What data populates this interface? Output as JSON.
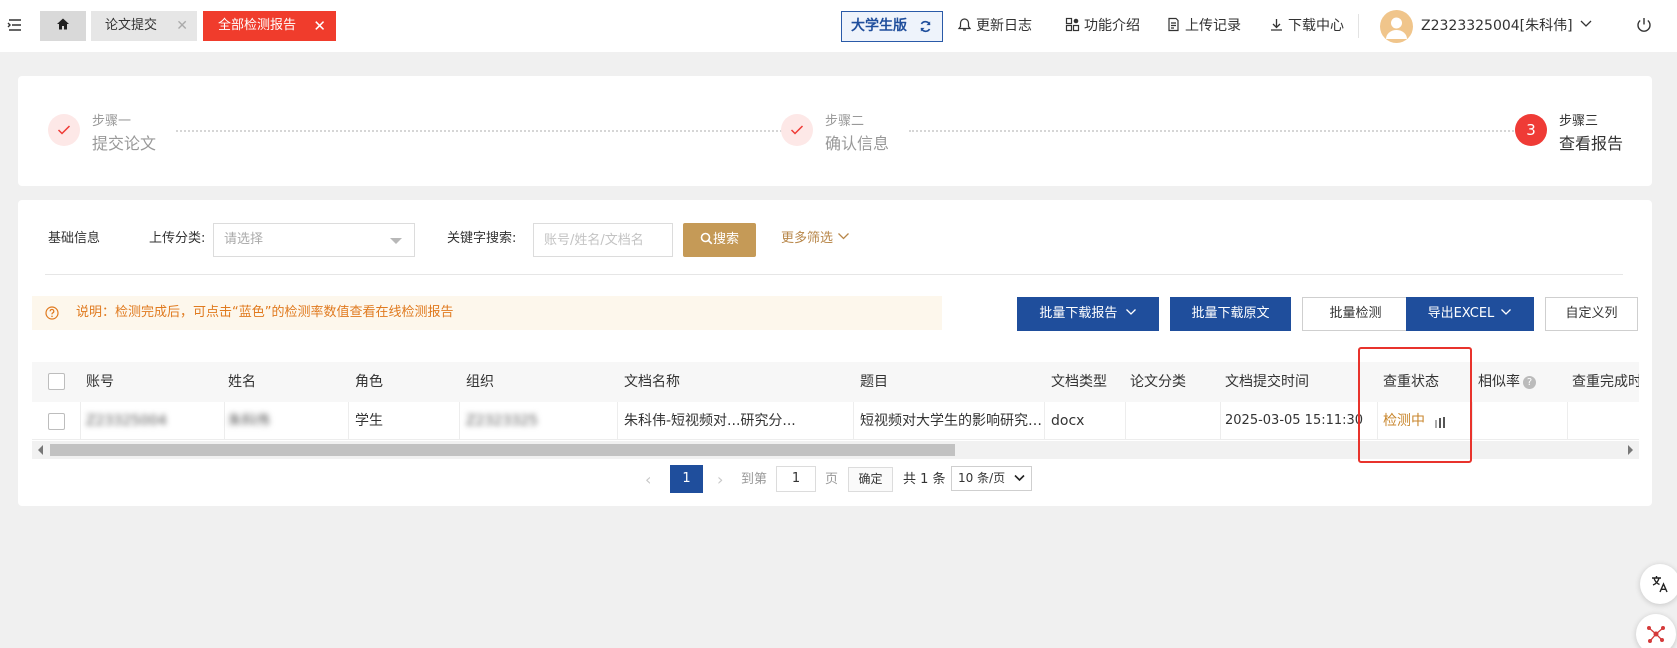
{
  "topbar": {
    "tabs": [
      {
        "label": ""
      },
      {
        "label": "论文提交"
      },
      {
        "label": "全部检测报告"
      }
    ],
    "version_label": "大学生版",
    "nav": {
      "update_log": "更新日志",
      "features": "功能介绍",
      "upload_records": "上传记录",
      "download_center": "下载中心"
    },
    "user_name": "Z2323325004[朱科伟]"
  },
  "steps": [
    {
      "sub": "步骤一",
      "main": "提交论文",
      "state": "done"
    },
    {
      "sub": "步骤二",
      "main": "确认信息",
      "state": "done"
    },
    {
      "number": "3",
      "sub": "步骤三",
      "main": "查看报告",
      "state": "current"
    }
  ],
  "filters": {
    "basic_info": "基础信息",
    "upload_category_label": "上传分类:",
    "upload_category_placeholder": "请选择",
    "keyword_label": "关键字搜索:",
    "keyword_placeholder": "账号/姓名/文档名",
    "search_button": "搜索",
    "more_filters": "更多筛选"
  },
  "notice": "说明：检测完成后，可点击“蓝色”的检测率数值查看在线检测报告",
  "actions": {
    "batch_download_report": "批量下载报告",
    "batch_download_original": "批量下载原文",
    "batch_check": "批量检测",
    "export_excel": "导出EXCEL",
    "custom_columns": "自定义列"
  },
  "table": {
    "headers": {
      "account": "账号",
      "name": "姓名",
      "role": "角色",
      "org": "组织",
      "doc_name": "文档名称",
      "title": "题目",
      "doc_type": "文档类型",
      "paper_category": "论文分类",
      "submit_time": "文档提交时间",
      "check_status": "查重状态",
      "similarity": "相似率",
      "finish_time": "查重完成时"
    },
    "rows": [
      {
        "account": "Z23325004",
        "name": "朱科伟",
        "role": "学生",
        "org": "Z2323325",
        "doc_name": "朱科伟-短视频对...研究分...",
        "title": "短视频对大学生的影响研究分...",
        "doc_type": "docx",
        "paper_category": "",
        "submit_time": "2025-03-05 15:11:30",
        "check_status": "检测中",
        "similarity": "",
        "finish_time": ""
      }
    ]
  },
  "pagination": {
    "current_page": "1",
    "goto_label": "到第",
    "goto_value": "1",
    "page_unit": "页",
    "confirm": "确定",
    "total": "共 1 条",
    "page_size": "10 条/页"
  },
  "colors": {
    "brand_blue": "#1f4e9c",
    "accent_red": "#f03c2c",
    "gold": "#c59a57",
    "status_orange": "#c8862c"
  }
}
